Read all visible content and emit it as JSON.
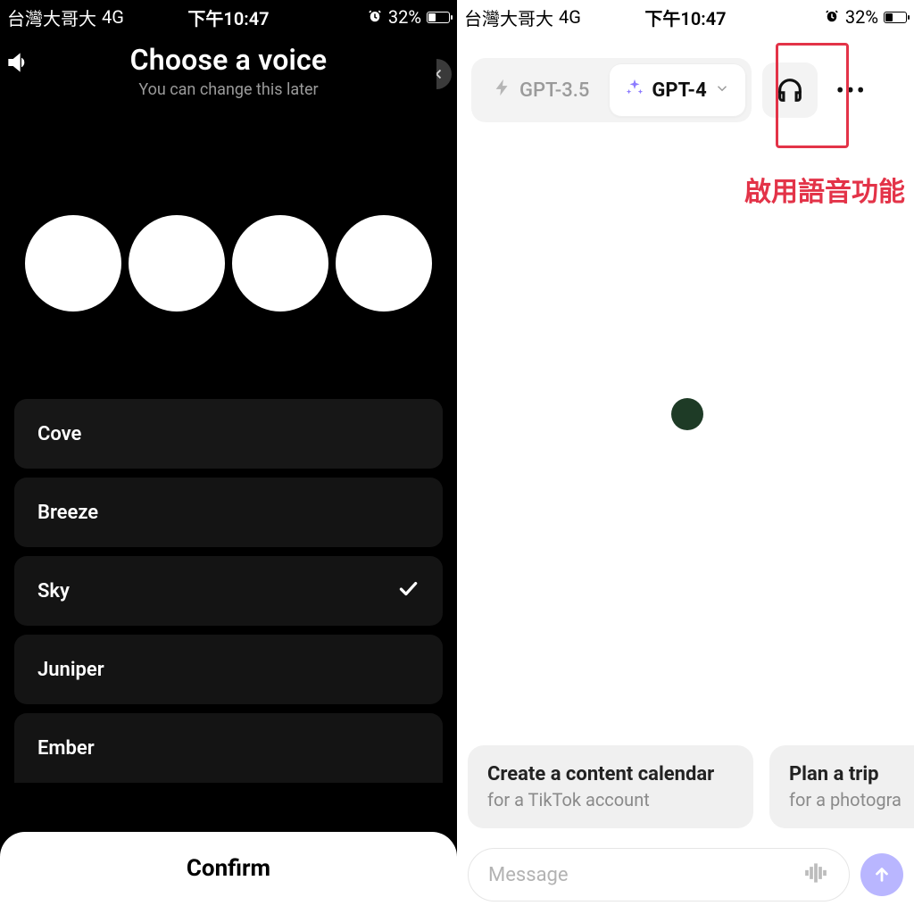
{
  "status": {
    "carrier": "台灣大哥大",
    "network": "4G",
    "time": "下午10:47",
    "battery_text": "32%"
  },
  "left": {
    "title": "Choose a voice",
    "subtitle": "You can change this later",
    "voices": [
      "Cove",
      "Breeze",
      "Sky",
      "Juniper",
      "Ember"
    ],
    "selected_index": 2,
    "confirm_label": "Confirm"
  },
  "right": {
    "models": {
      "inactive": "GPT-3.5",
      "active": "GPT-4"
    },
    "annotation": "啟用語音功能",
    "suggestions": [
      {
        "title": "Create a content calendar",
        "sub": "for a TikTok account"
      },
      {
        "title": "Plan a trip",
        "sub": "for a photogra"
      }
    ],
    "input_placeholder": "Message"
  },
  "colors": {
    "highlight": "#e33348",
    "sparkle": "#8c7bff",
    "send": "#b9b6ff",
    "dot": "#1e3b26"
  }
}
